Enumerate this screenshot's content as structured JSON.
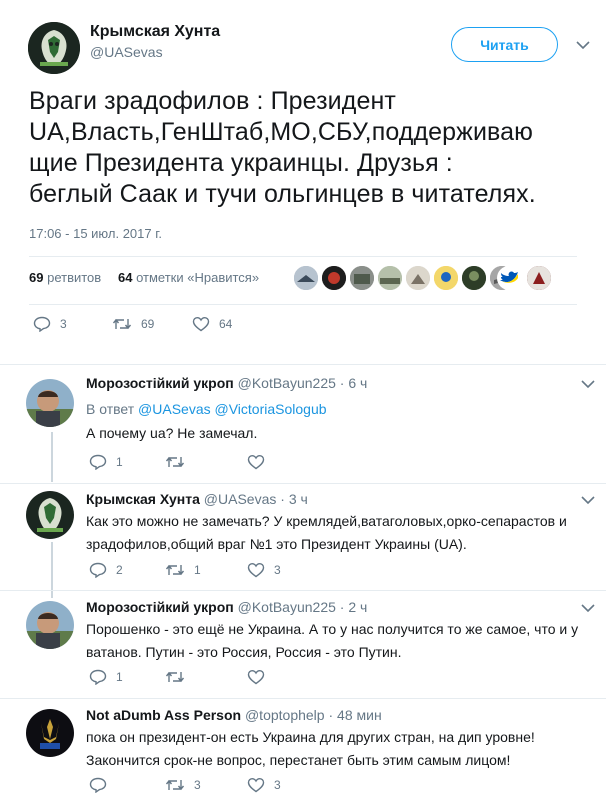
{
  "header": {
    "display_name": "Крымская Хунта",
    "handle": "@UASevas",
    "follow_label": "Читать"
  },
  "tweet": {
    "lines": [
      "Враги зрадофилов : Президент",
      "UA,Власть,ГенШтаб,МО,СБУ,поддерживаю",
      "щие Президента украинцы. Друзья :",
      "беглый Саак и тучи ольгинцев в читателях."
    ],
    "timestamp": "17:06 - 15 июл. 2017 г.",
    "retweets_count": "69",
    "retweets_label": "ретвитов",
    "likes_count": "64",
    "likes_label": "отметки «Нравится»",
    "actions": {
      "reply": "3",
      "retweet": "69",
      "like": "64"
    }
  },
  "replies": [
    {
      "display_name": "Морозостійкий укроп",
      "handle": "@KotBayun225",
      "time": "6 ч",
      "reply_to_prefix": "В ответ",
      "reply_to_1": "@UASevas",
      "reply_to_2": "@VictoriaSologub",
      "line1": "А почему ua? Не замечал.",
      "line2": "",
      "reply_count": "1",
      "retweet_count": "",
      "like_count": ""
    },
    {
      "display_name": "Крымская Хунта",
      "handle": "@UASevas",
      "time": "3 ч",
      "line1": "Как это можно не замечать? У кремлядей,ватаголовых,орко-сепарастов и",
      "line2": "зрадофилов,общий враг №1 это Президент Украины (UA).",
      "reply_count": "2",
      "retweet_count": "1",
      "like_count": "3"
    },
    {
      "display_name": "Морозостійкий укроп",
      "handle": "@KotBayun225",
      "time": "2 ч",
      "line1": "Порошенко - это ещё не Украина. А то у нас получится то же самое, что и у",
      "line2": "ватанов. Путин - это Россия, Россия - это Путин.",
      "reply_count": "1",
      "retweet_count": "",
      "like_count": ""
    },
    {
      "display_name": "Not aDumb Ass Person",
      "handle": "@toptophelp",
      "time": "48 мин",
      "line1": "пока он президент-он есть Украина для других стран, на дип уровне!",
      "line2": "Закончится срок-не вопрос, перестанет быть этим самым лицом!",
      "reply_count": "",
      "retweet_count": "3",
      "like_count": "3"
    }
  ],
  "colors": {
    "accent": "#1da1f2",
    "link": "#1b95e0",
    "muted": "#657786",
    "like_ukraine_blue": "#0057b7",
    "like_ukraine_yellow": "#ffd700"
  }
}
